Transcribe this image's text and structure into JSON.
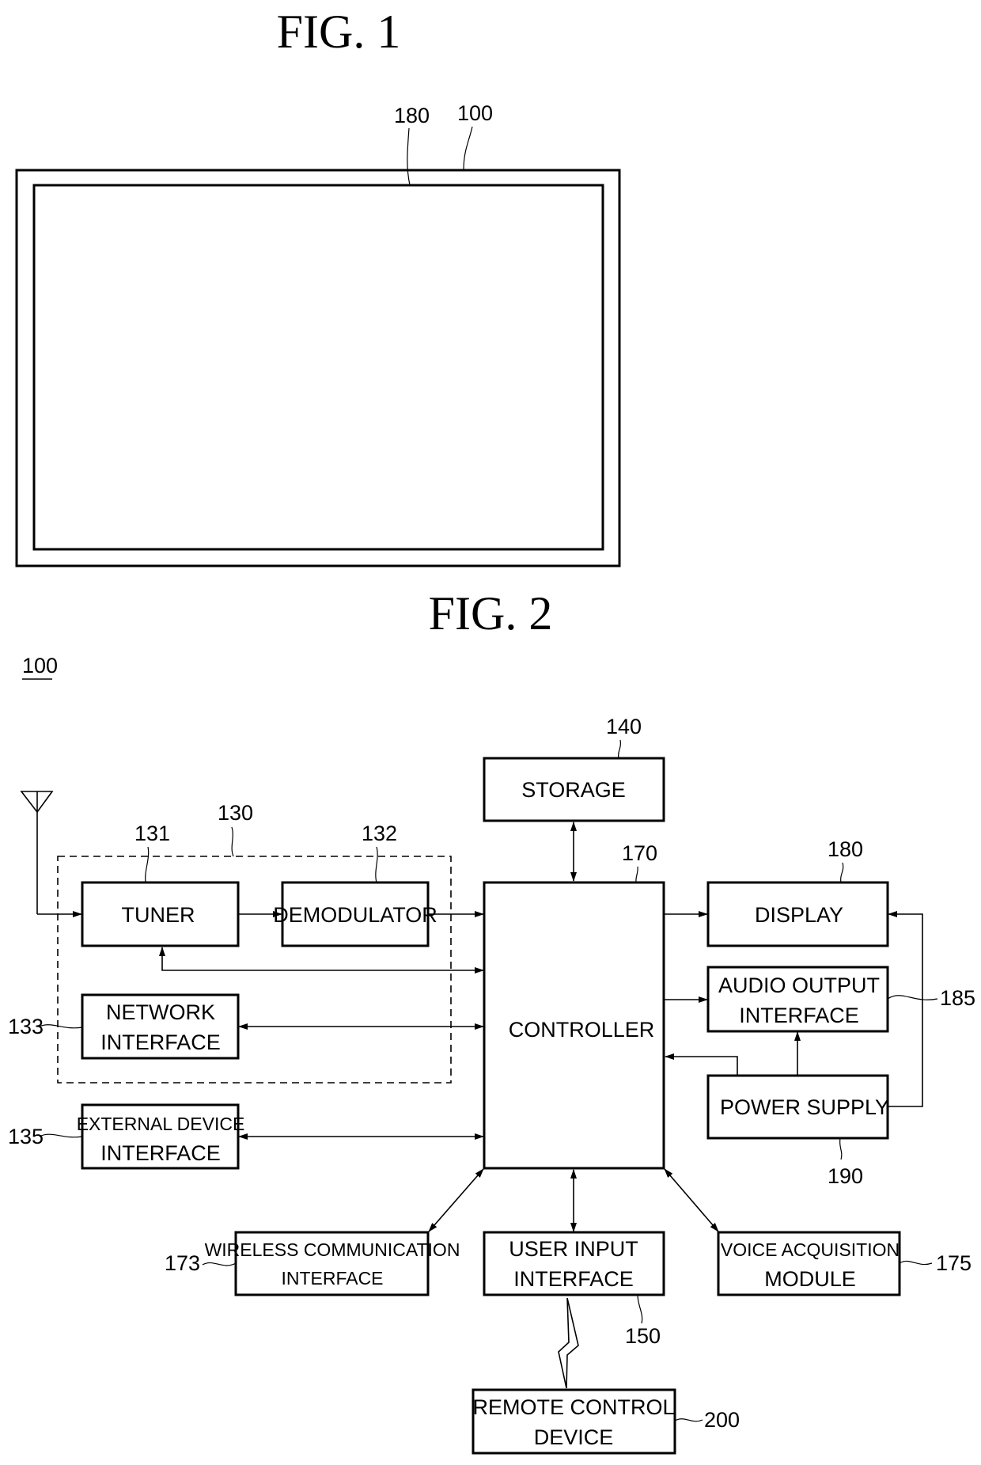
{
  "fig1": {
    "title": "FIG. 1",
    "refs": {
      "display": "180",
      "device": "100"
    }
  },
  "fig2": {
    "title": "FIG. 2",
    "device_ref": "100",
    "group_ref": "130",
    "blocks": {
      "storage": {
        "label": [
          "STORAGE"
        ],
        "ref": "140"
      },
      "controller": {
        "label": [
          "CONTROLLER"
        ],
        "ref": "170"
      },
      "display": {
        "label": [
          "DISPLAY"
        ],
        "ref": "180"
      },
      "audio_output": {
        "label": [
          "AUDIO OUTPUT",
          "INTERFACE"
        ],
        "ref": "185"
      },
      "power_supply": {
        "label": [
          "POWER SUPPLY"
        ],
        "ref": "190"
      },
      "tuner": {
        "label": [
          "TUNER"
        ],
        "ref": "131"
      },
      "demodulator": {
        "label": [
          "DEMODULATOR"
        ],
        "ref": "132"
      },
      "network_interface": {
        "label": [
          "NETWORK",
          "INTERFACE"
        ],
        "ref": "133"
      },
      "external_device_interface": {
        "label": [
          "EXTERNAL DEVICE",
          "INTERFACE"
        ],
        "ref": "135"
      },
      "wireless_communication_interface": {
        "label": [
          "WIRELESS COMMUNICATION",
          "INTERFACE"
        ],
        "ref": "173"
      },
      "user_input_interface": {
        "label": [
          "USER INPUT",
          "INTERFACE"
        ],
        "ref": "150"
      },
      "voice_acquisition_module": {
        "label": [
          "VOICE ACQUISITION",
          "MODULE"
        ],
        "ref": "175"
      },
      "remote_control_device": {
        "label": [
          "REMOTE CONTROL",
          "DEVICE"
        ],
        "ref": "200"
      }
    }
  }
}
